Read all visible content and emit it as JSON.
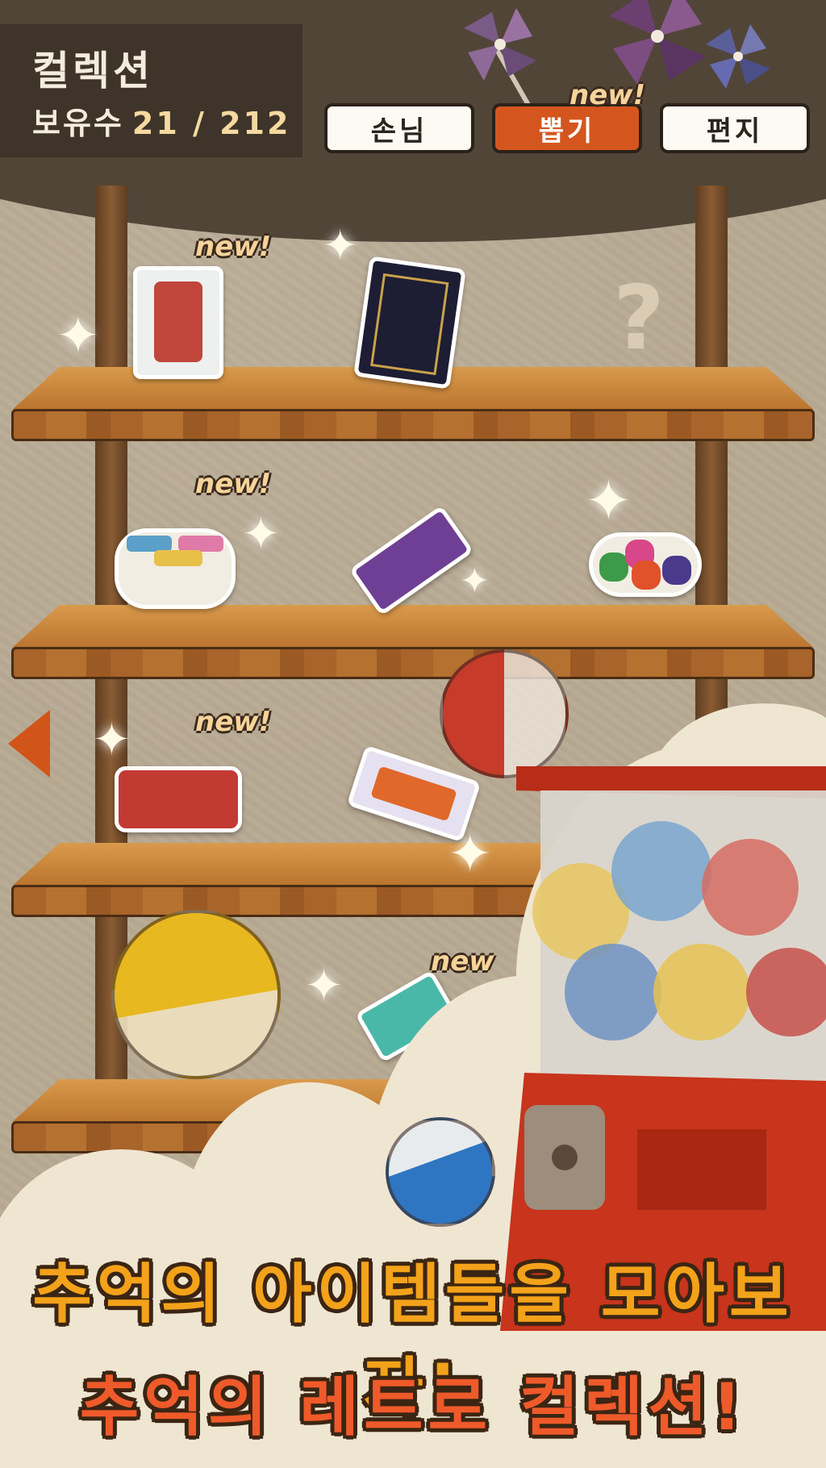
{
  "header": {
    "title": "컬렉션",
    "owned_label": "보유수",
    "owned_count": "21 / 212"
  },
  "tabs": [
    {
      "label": "손님",
      "active": false
    },
    {
      "label": "뽑기",
      "active": true,
      "badge": "new!"
    },
    {
      "label": "편지",
      "active": false
    }
  ],
  "shelves": [
    {
      "new_label": "new!",
      "unknown_mark": "?"
    },
    {
      "new_label": "new!"
    },
    {
      "new_label": "new!"
    },
    {
      "new_label": "new"
    }
  ],
  "slogans": {
    "line1": "추억의 아이템들을 모아보자!",
    "line2": "추억의 레트로 컬렉션!"
  },
  "colors": {
    "header_bg": "#514538",
    "active_tab": "#d4561e",
    "slogan1": "#f3a21a",
    "slogan2": "#ef5a2a",
    "machine_red": "#c8341c"
  },
  "icons": [
    "left-arrow-icon",
    "sparkle-icon",
    "pinwheel-icon",
    "question-mark-icon"
  ]
}
